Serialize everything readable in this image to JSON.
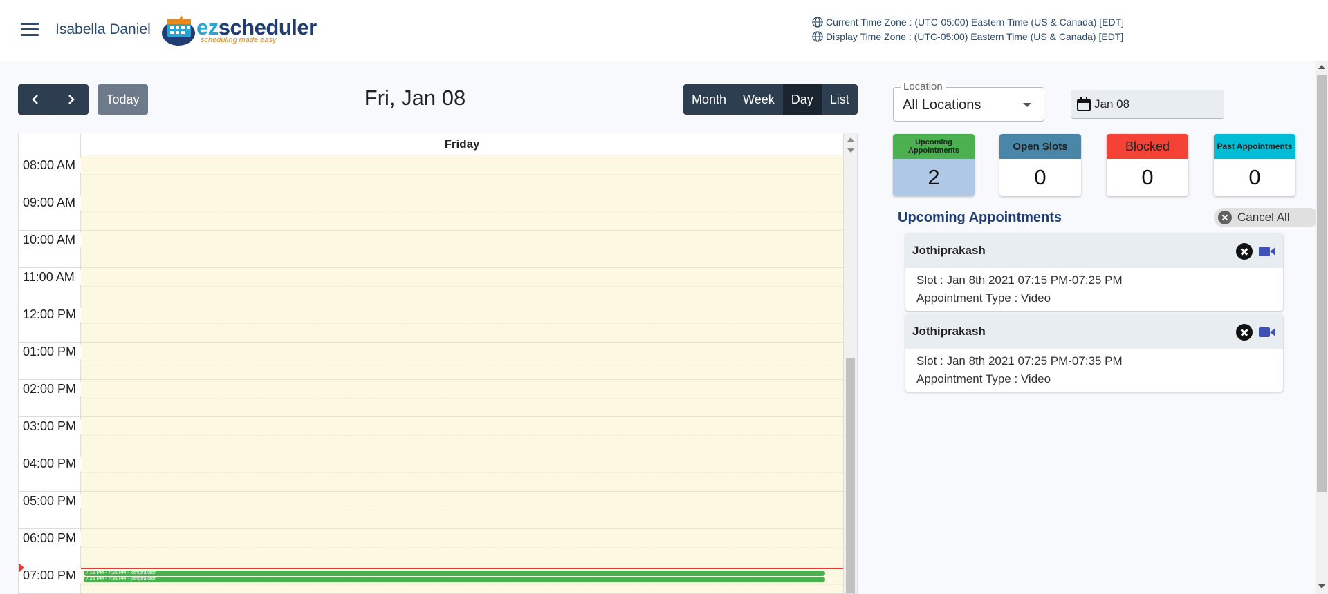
{
  "header": {
    "user_name": "Isabella Daniel",
    "logo_prefix": "ez",
    "logo_suffix": "scheduler",
    "logo_tagline": "scheduling made easy",
    "current_tz": "Current Time Zone : (UTC-05:00) Eastern Time (US & Canada) [EDT]",
    "display_tz": "Display Time Zone : (UTC-05:00) Eastern Time (US & Canada) [EDT]",
    "menu_icon": "hamburger-menu-icon",
    "globe_icon": "globe-icon"
  },
  "toolbar": {
    "prev_icon": "chevron-left-icon",
    "next_icon": "chevron-right-icon",
    "today_label": "Today",
    "title": "Fri, Jan 08",
    "views": [
      "Month",
      "Week",
      "Day",
      "List"
    ],
    "active_view": "Day"
  },
  "calendar": {
    "day_header": "Friday",
    "times": [
      "08:00 AM",
      "09:00 AM",
      "10:00 AM",
      "11:00 AM",
      "12:00 PM",
      "01:00 PM",
      "02:00 PM",
      "03:00 PM",
      "04:00 PM",
      "05:00 PM",
      "06:00 PM",
      "07:00 PM"
    ],
    "events": [
      {
        "label": "7:15 PM - 7:25 PM - jothiprakash",
        "color": "#4caf50"
      },
      {
        "label": "7:25 PM - 7:35 PM - jothiprakash",
        "color": "#4caf50"
      }
    ],
    "now_indicator_color": "#e53935"
  },
  "filters": {
    "location_label": "Location",
    "location_value": "All Locations",
    "date_value": "Jan 08",
    "date_icon": "calendar-icon"
  },
  "stats": [
    {
      "label": "Upcoming Appointments",
      "value": "2",
      "color": "#4caf50"
    },
    {
      "label": "Open Slots",
      "value": "0",
      "color": "#4a86a8"
    },
    {
      "label": "Blocked",
      "value": "0",
      "color": "#f44336"
    },
    {
      "label": "Past Appointments",
      "value": "0",
      "color": "#00bcd4"
    }
  ],
  "upcoming": {
    "title": "Upcoming Appointments",
    "cancel_all_label": "Cancel All",
    "appointments": [
      {
        "name": "Jothiprakash",
        "slot": "Slot : Jan 8th 2021 07:15 PM-07:25 PM",
        "type": "Appointment Type : Video"
      },
      {
        "name": "Jothiprakash",
        "slot": "Slot : Jan 8th 2021 07:25 PM-07:35 PM",
        "type": "Appointment Type : Video"
      }
    ]
  },
  "colors": {
    "primary": "#2c3e50",
    "brand_blue": "#1f3c74",
    "day_bg": "#fdf8e1"
  }
}
